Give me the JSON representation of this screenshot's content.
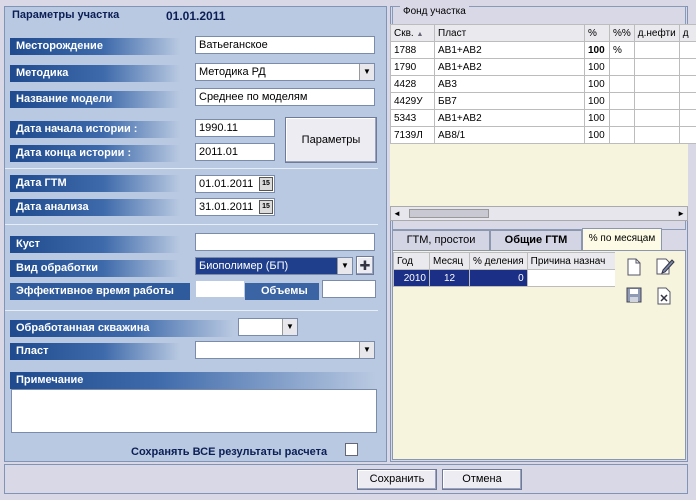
{
  "header": {
    "title": "Параметры участка",
    "date": "01.01.2011"
  },
  "fields": {
    "field_label": "Месторождение",
    "field_value": "Ватьеганское",
    "method_label": "Методика",
    "method_value": "Методика РД",
    "model_label": "Название модели",
    "model_value": "Среднее по моделям",
    "hist_start_label": "Дата начала истории :",
    "hist_start_value": "1990.11",
    "hist_end_label": "Дата конца истории :",
    "hist_end_value": "2011.01",
    "params_button": "Параметры",
    "gtm_date_label": "Дата ГТМ",
    "gtm_date_value": "01.01.2011",
    "analysis_date_label": "Дата анализа",
    "analysis_date_value": "31.01.2011",
    "cal_icon": "15",
    "bush_label": "Куст",
    "bush_value": "",
    "treatment_label": "Вид обработки",
    "treatment_value": "Биополимер (БП)",
    "eff_time_label": "Эффективное время работы",
    "volumes_label": "Объемы",
    "treated_well_label": "Обработанная скважина",
    "layer_label": "Пласт",
    "note_label": "Примечание",
    "save_all_label": "Сохранять ВСЕ результаты расчета"
  },
  "fund": {
    "title": "Фонд участка",
    "columns": [
      "Скв.",
      "Пласт",
      "%",
      "%%",
      "д.нефти",
      "д"
    ],
    "rows": [
      [
        "1788",
        "АВ1+АВ2",
        "100",
        "%"
      ],
      [
        "1790",
        "АВ1+АВ2",
        "100",
        ""
      ],
      [
        "4428",
        "АВ3",
        "100",
        ""
      ],
      [
        "4429У",
        "БВ7",
        "100",
        ""
      ],
      [
        "5343",
        "АВ1+АВ2",
        "100",
        ""
      ],
      [
        "7139Л",
        "АВ8/1",
        "100",
        ""
      ]
    ]
  },
  "tabs": [
    "ГТМ, простои",
    "Общие ГТМ",
    "% по месяцам"
  ],
  "monthly": {
    "columns": [
      "Год",
      "Месяц",
      "% деления",
      "Причина назнач"
    ],
    "rows": [
      [
        "2010",
        "12",
        "0",
        ""
      ]
    ]
  },
  "footer": {
    "save": "Сохранить",
    "cancel": "Отмена"
  },
  "icons": {
    "sort": "▲",
    "scroll_left": "◄",
    "scroll_right": "►",
    "dropdown": "▼",
    "add": "✚"
  }
}
